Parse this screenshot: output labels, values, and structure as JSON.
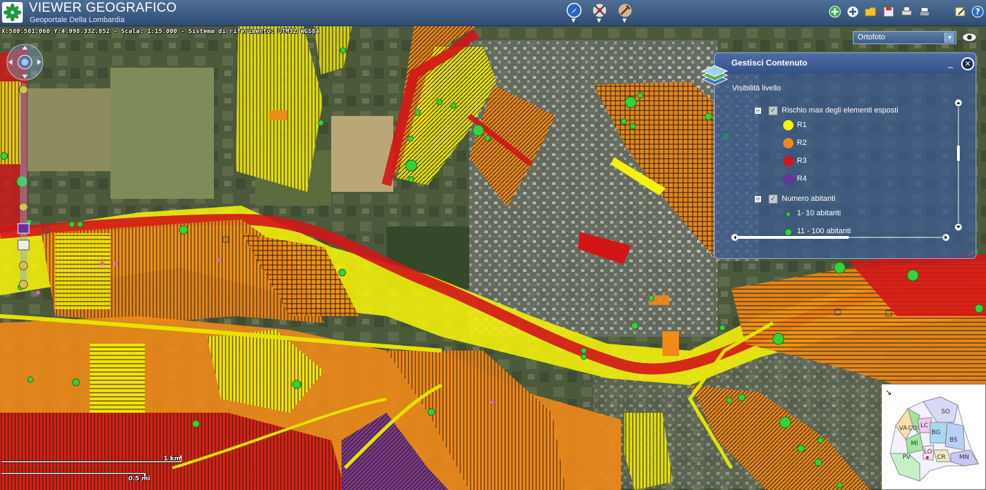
{
  "header": {
    "title": "VIEWER GEOGRAFICO",
    "subtitle": "Geoportale Della Lombardia",
    "logo_icon": "lombardia-rose-logo",
    "center_tools": [
      "compass-tool-icon",
      "measure-tool-icon",
      "draw-tool-icon"
    ],
    "right_tools": [
      "add-layer-icon",
      "add-content-icon",
      "open-folder-icon",
      "save-icon",
      "print-icon",
      "share-icon",
      "edit-icon",
      "help-icon"
    ]
  },
  "status": {
    "coordinates": "X:580.581,060 Y:4.998.332,852 - Scala: 1:15.000 - Sistema di riferimento: UTM32 WGS84"
  },
  "basemap": {
    "selected": "Ortofoto",
    "icon": "eye-icon"
  },
  "panel": {
    "title": "Gestisci Contenuto",
    "visibility_label": "Visibilità livello",
    "group1": {
      "label": "Rischio max degli elementi esposti",
      "items": [
        {
          "label": "R1",
          "color": "#f5f20a"
        },
        {
          "label": "R2",
          "color": "#f08a18"
        },
        {
          "label": "R3",
          "color": "#d31518"
        },
        {
          "label": "R4",
          "color": "#6b2f9e"
        }
      ]
    },
    "group2": {
      "label": "Numero abitanti",
      "items": [
        {
          "label": "1- 10 abitanti",
          "color": "#35d33a"
        },
        {
          "label": "11 - 100 abitanti",
          "color": "#35d33a"
        }
      ]
    }
  },
  "overview": {
    "provinces": [
      "SO",
      "VA",
      "CO",
      "LC",
      "BG",
      "BS",
      "MI",
      "LO",
      "CR",
      "MN",
      "PV"
    ]
  },
  "scale": {
    "km_label": "1 km",
    "mi_label": "0.5 mi"
  },
  "colors": {
    "r1_yellow": "#f5f20a",
    "r2_orange": "#f08a18",
    "r3_red": "#d31518",
    "r4_purple": "#6b2f9e",
    "inhabitants_green": "#35d33a",
    "header_blue": "#3a5a82"
  }
}
